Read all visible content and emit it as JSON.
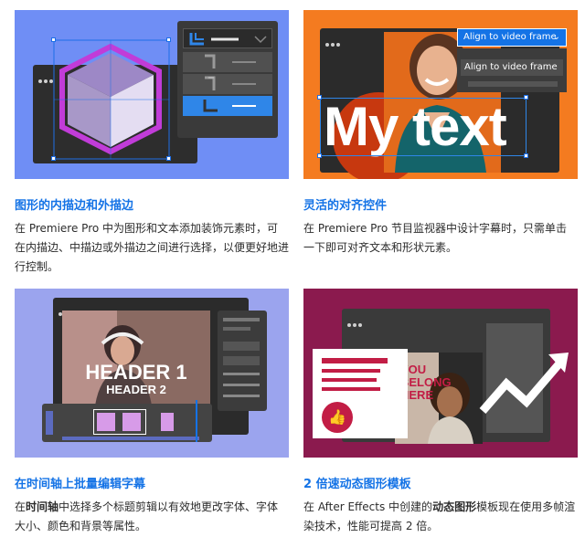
{
  "cards": [
    {
      "title": "图形的内描边和外描边",
      "desc": "在 Premiere Pro 中为图形和文本添加装饰元素时，可在内描边、中描边或外描边之间进行选择，以便更好地进行控制。",
      "colors": {
        "bg": "#6f8ef5",
        "cube_top": "#9d88c6",
        "cube_left": "#a898c8",
        "cube_right": "#e4ddf2",
        "stroke": "#c13cd8",
        "selected_row": "#2f86e8"
      }
    },
    {
      "title": "灵活的对齐控件",
      "desc": "在 Premiere Pro 节目监视器中设计字幕时，只需单击一下即可对齐文本和形状元素。",
      "dropdown_label": "Align to video frame",
      "menu_item_label": "Align to video frame",
      "overlay_text": "My text",
      "colors": {
        "bg": "#f47b20",
        "accent": "#1473e6"
      }
    },
    {
      "title": "在时间轴上批量编辑字幕",
      "desc_prefix": "在",
      "desc_bold": "时间轴",
      "desc_suffix": "中选择多个标题剪辑以有效地更改字体、字体大小、颜色和背景等属性。",
      "header1": "HEADER 1",
      "header2": "HEADER 2",
      "colors": {
        "bg": "#9ba4ee",
        "clip": "#d79be8"
      }
    },
    {
      "title": "2 倍速动态图形模板",
      "desc_prefix": "在 After Effects 中创建的",
      "desc_bold": "动态图形",
      "desc_suffix": "模板现在使用多帧渲染技术，性能可提高 2 倍。",
      "poster_text": "YOU BELONG HERE",
      "colors": {
        "bg": "#8b1a4e",
        "red": "#c21d45"
      }
    }
  ]
}
